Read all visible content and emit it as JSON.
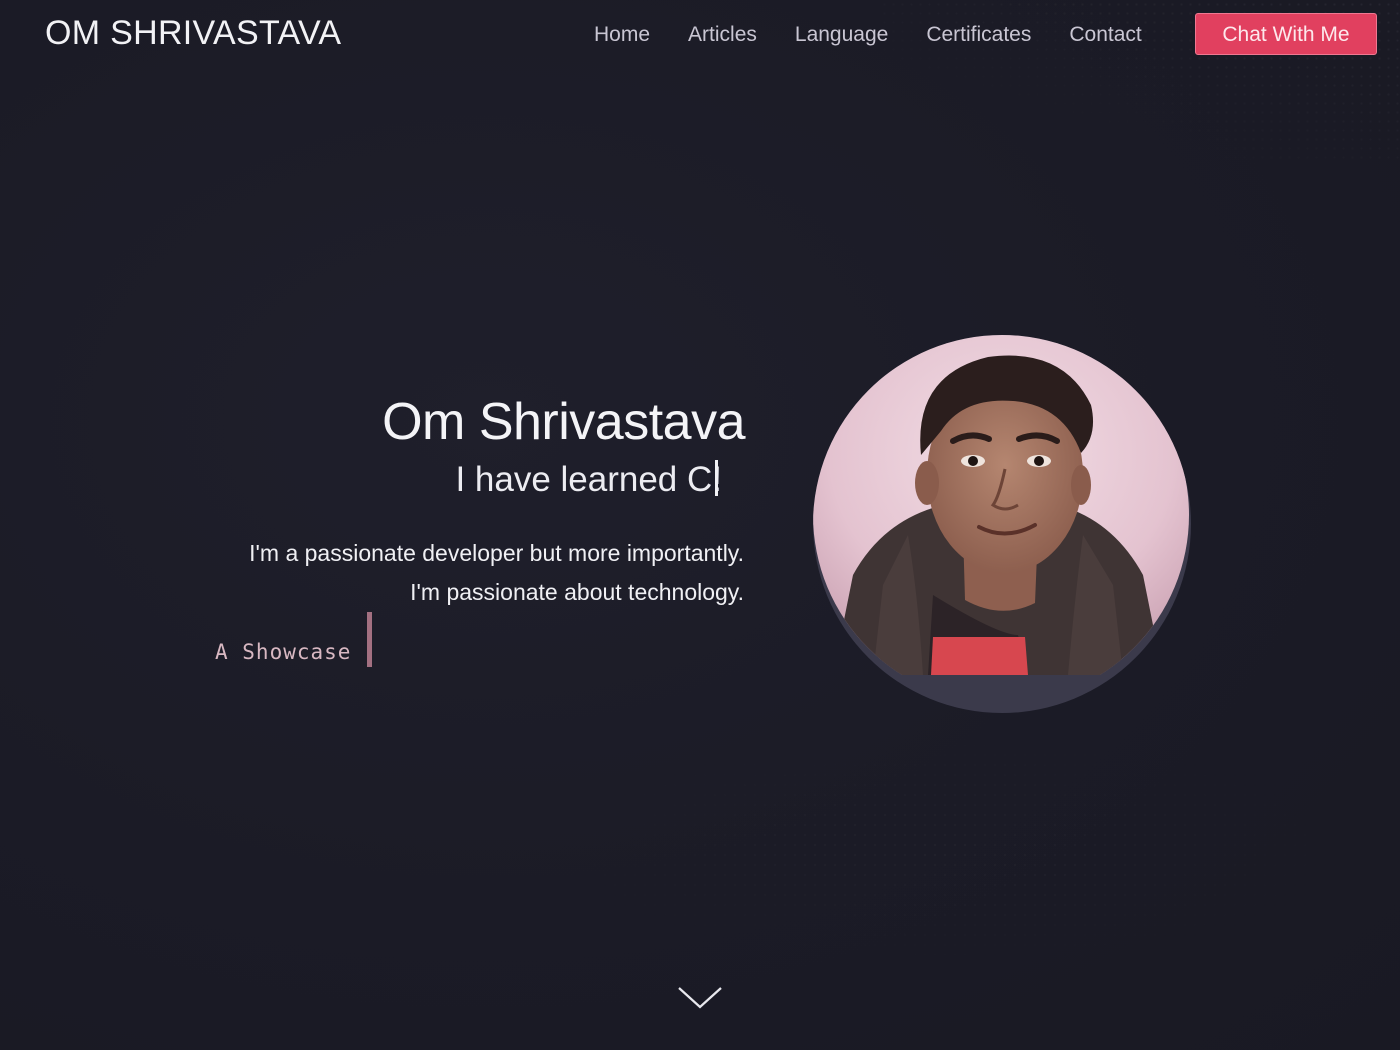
{
  "header": {
    "brand": "OM SHRIVASTAVA",
    "nav": [
      {
        "label": "Home"
      },
      {
        "label": "Articles"
      },
      {
        "label": "Language"
      },
      {
        "label": "Certificates"
      },
      {
        "label": "Contact"
      }
    ],
    "cta_label": "Chat With Me"
  },
  "hero": {
    "name": "Om Shrivastava",
    "typed_heading": "I have learned C!",
    "description_line1": "I'm a passionate developer but more importantly.",
    "description_line2": "I'm passionate about technology.",
    "typed_tagline": "A Showcase o"
  },
  "icons": {
    "profile": "profile-photo",
    "scroll": "chevron-down-icon"
  },
  "colors": {
    "background": "#1b1b26",
    "accent": "#e1405f",
    "avatar_base": "#3b3a4b",
    "typed_text": "#d8b8c2"
  }
}
